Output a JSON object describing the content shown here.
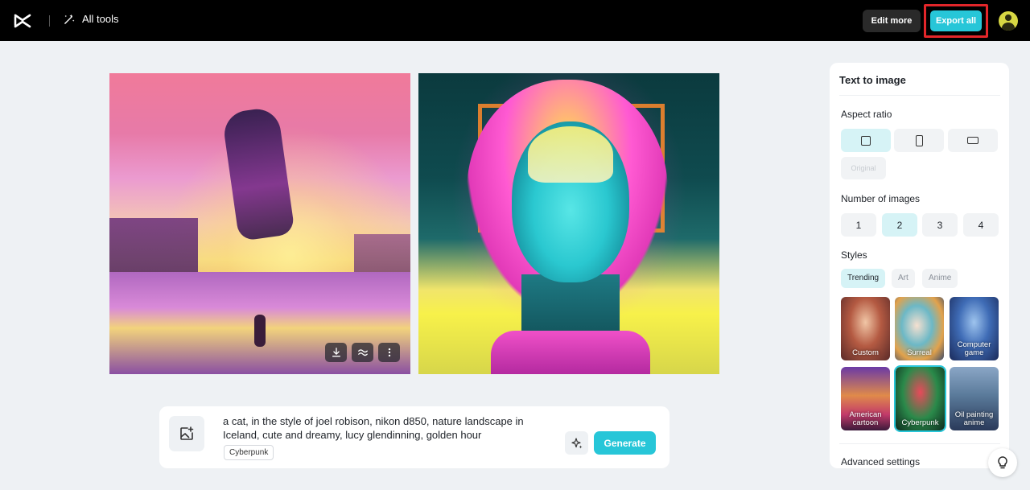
{
  "topbar": {
    "all_tools_label": "All tools",
    "edit_more_label": "Edit more",
    "export_all_label": "Export all"
  },
  "prompt": {
    "text": "a cat, in the style of joel robison, nikon d850, nature landscape in Iceland, cute and dreamy, lucy glendinning, golden hour",
    "style_chip": "Cyberpunk",
    "generate_label": "Generate"
  },
  "panel": {
    "title": "Text to image",
    "aspect_ratio_label": "Aspect ratio",
    "aspect_options": [
      "square",
      "portrait",
      "landscape"
    ],
    "aspect_selected": "square",
    "original_label": "Original",
    "number_label": "Number of images",
    "numbers": [
      "1",
      "2",
      "3",
      "4"
    ],
    "number_selected": "2",
    "styles_label": "Styles",
    "style_tabs": [
      "Trending",
      "Art",
      "Anime"
    ],
    "style_tab_selected": "Trending",
    "style_tiles": [
      "Custom",
      "Surreal",
      "Computer game",
      "American cartoon",
      "Cyberpunk",
      "Oil painting anime"
    ],
    "style_tile_selected": "Cyberpunk",
    "advanced_label": "Advanced settings"
  },
  "colors": {
    "accent": "#27c6d8",
    "accent_soft": "#d6f3f6",
    "highlight_border": "#e3262a"
  },
  "icons": {
    "logo": "capcut-logo-icon",
    "all_tools": "magic-wand-icon",
    "download": "download-icon",
    "variations": "waves-icon",
    "more": "more-vertical-icon",
    "add_image": "add-image-icon",
    "magic_prompt": "sparkle-icon",
    "help": "lightbulb-icon"
  }
}
